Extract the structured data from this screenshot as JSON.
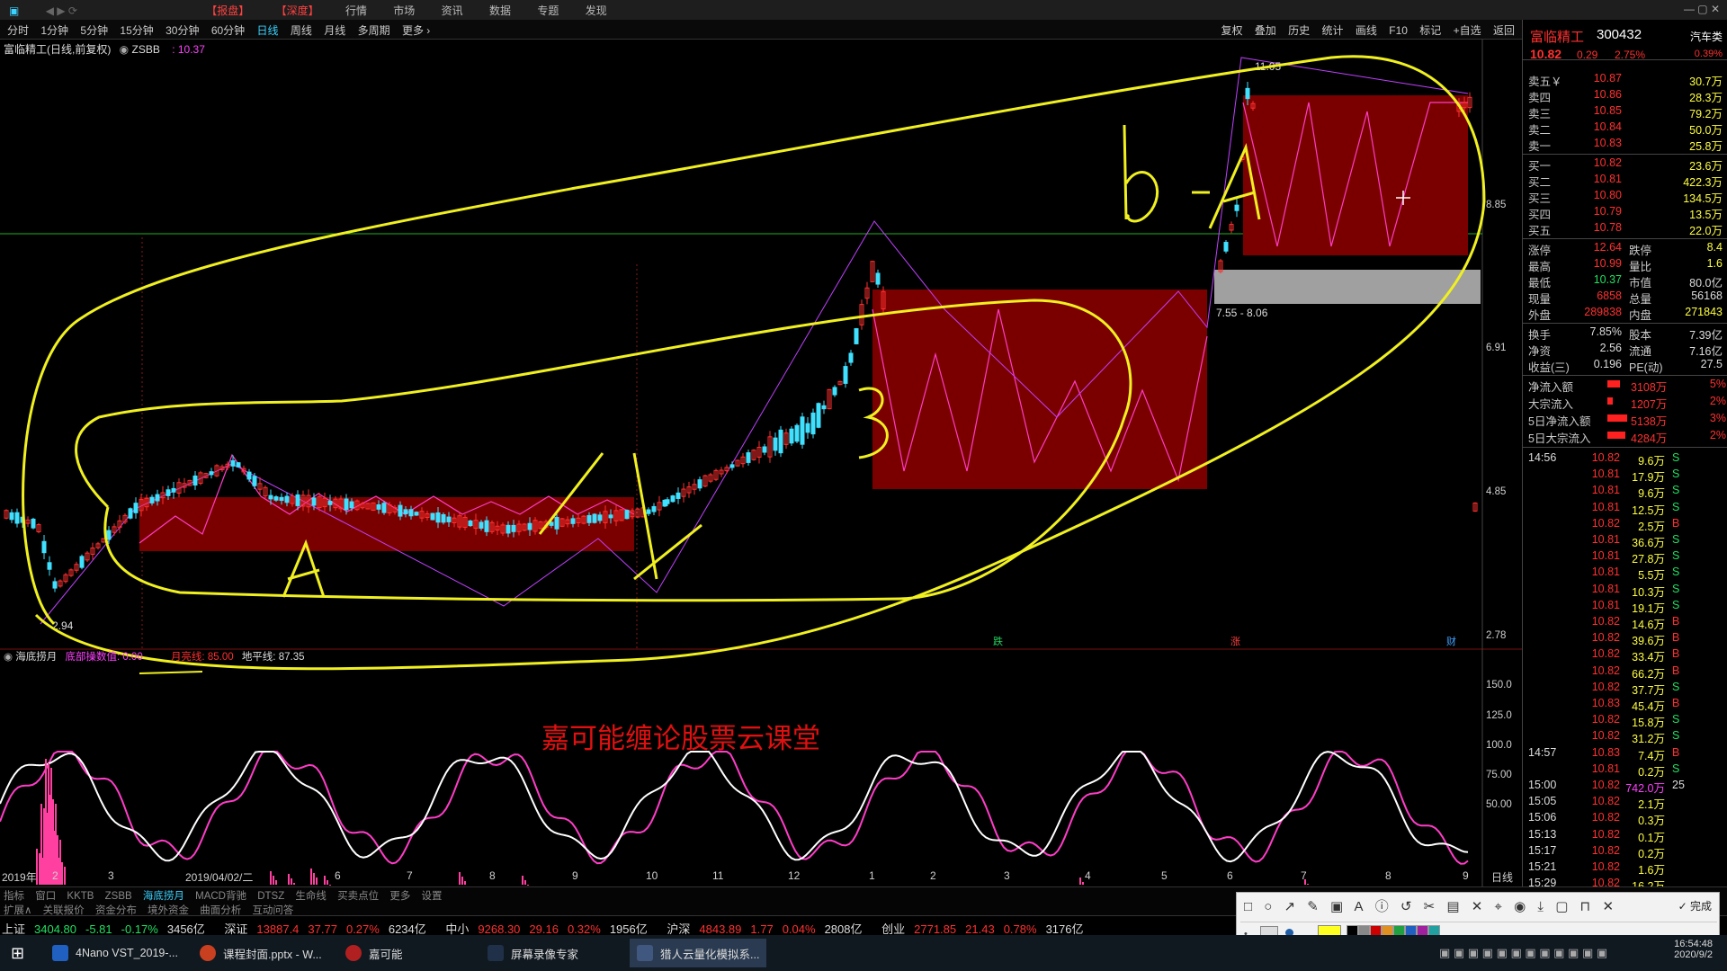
{
  "topbar": {
    "items": [
      "【报盘】",
      "【深度】",
      "行情",
      "市场",
      "资讯",
      "数据",
      "专题",
      "发现"
    ]
  },
  "periods": {
    "items": [
      "分时",
      "1分钟",
      "5分钟",
      "15分钟",
      "30分钟",
      "60分钟",
      "日线",
      "周线",
      "月线",
      "多周期",
      "更多 ›"
    ],
    "active": "日线"
  },
  "tools": [
    "复权",
    "叠加",
    "历史",
    "统计",
    "画线",
    "F10",
    "标记",
    "+自选",
    "返回"
  ],
  "chart": {
    "title": "富临精工(日线,前复权)",
    "zsbb": "ZSBB",
    "value": ": 10.37",
    "y_labels": [
      "8.85",
      "6.91",
      "4.85",
      "2.78"
    ],
    "x_labels": [
      "2019年",
      "2",
      "3",
      "2019/04/02/二",
      "6",
      "7",
      "8",
      "9",
      "10",
      "11",
      "12",
      "1",
      "2",
      "3",
      "4",
      "5",
      "6",
      "7",
      "8",
      "9"
    ],
    "ann_high": "11.05",
    "ann_low": "2.94",
    "ann_range": "7.55 - 8.06",
    "markers": [
      "跌",
      "涨",
      "财"
    ]
  },
  "indicator": {
    "name": "海底捞月",
    "bottom": "底部操数值: 0.00",
    "top": "月亮线: 85.00",
    "horizon": "地平线: 87.35",
    "y_labels": [
      "150.0",
      "125.0",
      "100.0",
      "75.00",
      "50.00"
    ],
    "watermark": "嘉可能缠论股票云课堂",
    "period_label": "日线"
  },
  "handwriting": {
    "b1": "b-A",
    "b2": "B",
    "a1": "A",
    "a2": "A"
  },
  "quote": {
    "name": "富临精工",
    "code": "300432",
    "category": "汽车类",
    "price": "10.82",
    "change": "0.29",
    "pct": "2.75%",
    "ratio": "0.39%",
    "sell": [
      {
        "label": "卖五￥",
        "price": "10.87",
        "vol": "30.7万"
      },
      {
        "label": "卖四",
        "price": "10.86",
        "vol": "28.3万"
      },
      {
        "label": "卖三",
        "price": "10.85",
        "vol": "79.2万"
      },
      {
        "label": "卖二",
        "price": "10.84",
        "vol": "50.0万"
      },
      {
        "label": "卖一",
        "price": "10.83",
        "vol": "25.8万"
      }
    ],
    "buy": [
      {
        "label": "买一",
        "price": "10.82",
        "vol": "23.6万"
      },
      {
        "label": "买二",
        "price": "10.81",
        "vol": "422.3万"
      },
      {
        "label": "买三",
        "price": "10.80",
        "vol": "134.5万"
      },
      {
        "label": "买四",
        "price": "10.79",
        "vol": "13.5万"
      },
      {
        "label": "买五",
        "price": "10.78",
        "vol": "22.0万"
      }
    ],
    "stats": [
      {
        "k1": "涨停",
        "v1": "12.64",
        "k2": "跌停",
        "v2": "8.4"
      },
      {
        "k1": "最高",
        "v1": "10.99",
        "k2": "量比",
        "v2": "1.6"
      },
      {
        "k1": "最低",
        "v1": "10.37",
        "k2": "市值",
        "v2": "80.0亿"
      },
      {
        "k1": "现量",
        "v1": "6858",
        "k2": "总量",
        "v2": "56168"
      },
      {
        "k1": "外盘",
        "v1": "289838",
        "k2": "内盘",
        "v2": "271843"
      }
    ],
    "stats2": [
      {
        "k1": "换手",
        "v1": "7.85%",
        "k2": "股本",
        "v2": "7.39亿"
      },
      {
        "k1": "净资",
        "v1": "2.56",
        "k2": "流通",
        "v2": "7.16亿"
      },
      {
        "k1": "收益(三)",
        "v1": "0.196",
        "k2": "PE(动)",
        "v2": "27.5"
      }
    ],
    "flows": [
      {
        "label": "净流入额",
        "val": "3108万",
        "pct": "5%"
      },
      {
        "label": "大宗流入",
        "val": "1207万",
        "pct": "2%"
      },
      {
        "label": "5日净流入额",
        "val": "5138万",
        "pct": "3%"
      },
      {
        "label": "5日大宗流入",
        "val": "4284万",
        "pct": "2%"
      }
    ],
    "ticks": [
      {
        "t": "14:56",
        "p": "10.82",
        "v": "9.6万",
        "f": "S"
      },
      {
        "t": "",
        "p": "10.81",
        "v": "17.9万",
        "f": "S"
      },
      {
        "t": "",
        "p": "10.81",
        "v": "9.6万",
        "f": "S"
      },
      {
        "t": "",
        "p": "10.81",
        "v": "12.5万",
        "f": "S"
      },
      {
        "t": "",
        "p": "10.82",
        "v": "2.5万",
        "f": "B"
      },
      {
        "t": "",
        "p": "10.81",
        "v": "36.6万",
        "f": "S"
      },
      {
        "t": "",
        "p": "10.81",
        "v": "27.8万",
        "f": "S"
      },
      {
        "t": "",
        "p": "10.81",
        "v": "5.5万",
        "f": "S"
      },
      {
        "t": "",
        "p": "10.81",
        "v": "10.3万",
        "f": "S"
      },
      {
        "t": "",
        "p": "10.81",
        "v": "19.1万",
        "f": "S"
      },
      {
        "t": "",
        "p": "10.82",
        "v": "14.6万",
        "f": "B"
      },
      {
        "t": "",
        "p": "10.82",
        "v": "39.6万",
        "f": "B"
      },
      {
        "t": "",
        "p": "10.82",
        "v": "33.4万",
        "f": "B"
      },
      {
        "t": "",
        "p": "10.82",
        "v": "66.2万",
        "f": "B"
      },
      {
        "t": "",
        "p": "10.82",
        "v": "37.7万",
        "f": "S"
      },
      {
        "t": "",
        "p": "10.83",
        "v": "45.4万",
        "f": "B"
      },
      {
        "t": "",
        "p": "10.82",
        "v": "15.8万",
        "f": "S"
      },
      {
        "t": "",
        "p": "10.82",
        "v": "31.2万",
        "f": "S"
      },
      {
        "t": "14:57",
        "p": "10.83",
        "v": "7.4万",
        "f": "B"
      },
      {
        "t": "",
        "p": "10.81",
        "v": "0.2万",
        "f": "S"
      },
      {
        "t": "15:00",
        "p": "10.82",
        "v": "742.0万",
        "f": "25"
      },
      {
        "t": "15:05",
        "p": "10.82",
        "v": "2.1万",
        "f": ""
      },
      {
        "t": "15:06",
        "p": "10.82",
        "v": "0.3万",
        "f": ""
      },
      {
        "t": "15:13",
        "p": "10.82",
        "v": "0.1万",
        "f": ""
      },
      {
        "t": "15:17",
        "p": "10.82",
        "v": "0.2万",
        "f": ""
      },
      {
        "t": "15:21",
        "p": "10.82",
        "v": "1.6万",
        "f": ""
      },
      {
        "t": "15:29",
        "p": "10.82",
        "v": "16.2万",
        "f": ""
      }
    ]
  },
  "bottom_tabs1": [
    "指标",
    "窗口",
    "KKTB",
    "ZSBB",
    "海底捞月",
    "MACD背驰",
    "DTSZ",
    "生命线",
    "买卖点位",
    "更多",
    "设置"
  ],
  "bottom_tabs2": [
    "扩展∧",
    "关联报价",
    "资金分布",
    "境外资金",
    "曲面分析",
    "互动问答"
  ],
  "index_bar": [
    {
      "name": "上证",
      "v": "3404.80",
      "c": "-5.81",
      "p": "-0.17%",
      "a": "3456亿"
    },
    {
      "name": "深证",
      "v": "13887.4",
      "c": "37.77",
      "p": "0.27%",
      "a": "6234亿"
    },
    {
      "name": "中小",
      "v": "9268.30",
      "c": "29.16",
      "p": "0.32%",
      "a": "1956亿"
    },
    {
      "name": "沪深",
      "v": "4843.89",
      "c": "1.77",
      "p": "0.04%",
      "a": "2808亿"
    },
    {
      "name": "创业",
      "v": "2771.85",
      "c": "21.43",
      "p": "0.78%",
      "a": "3176亿"
    }
  ],
  "draw_toolbar": {
    "done": "完成",
    "icons": [
      "□",
      "○",
      "↗",
      "✎",
      "▣",
      "A",
      "ⓘ",
      "↺",
      "✂",
      "▤",
      "✕",
      "⌖",
      "◉",
      "⤓",
      "▢",
      "⊓",
      "✕"
    ]
  },
  "taskbar": {
    "items": [
      "4Nano VST_2019-...",
      "课程封面.pptx - W...",
      "嘉可能",
      "屏幕录像专家",
      "猎人云量化模拟系..."
    ],
    "time": "16:54:48",
    "date": "2020/9/2"
  },
  "colors": {
    "up": "#ff3030",
    "down": "#40e0ff",
    "yellow": "#ffff40",
    "box": "#800000",
    "magenta": "#ff3cc8"
  }
}
